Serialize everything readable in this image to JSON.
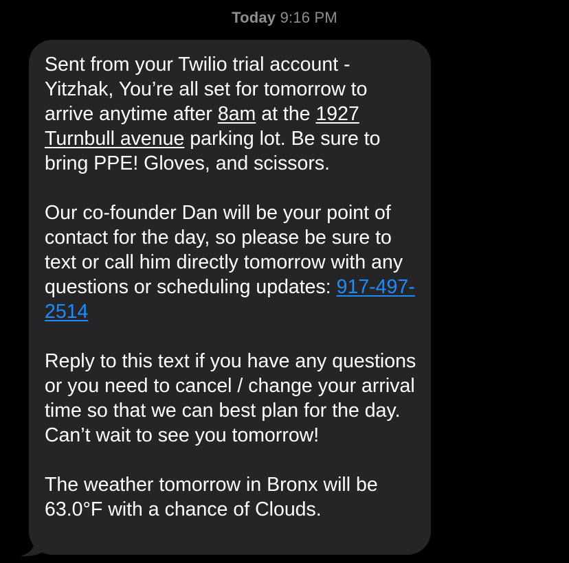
{
  "header": {
    "timestamp_day": "Today",
    "timestamp_time": "9:16 PM"
  },
  "message": {
    "p1_text_a": "Sent from your Twilio trial account - Yitzhak, You’re all set for tomorrow to arrive anytime after ",
    "p1_link_time": "8am",
    "p1_text_b": " at the ",
    "p1_link_address": "1927 Turnbull avenue",
    "p1_text_c": " parking lot.  Be sure to bring PPE! Gloves, and scissors.",
    "p2_text_a": "Our co-founder Dan will be your point of contact for the day, so please be sure to text or call him directly tomorrow with any questions or scheduling updates: ",
    "p2_link_phone": "917-497-2514",
    "p3_text": "Reply to this text if you have any questions or you need to cancel / change your arrival time so that we can best plan for the day. Can’t wait to see you tomorrow!",
    "p4_text": "The weather tomorrow in Bronx will be 63.0°F with a chance of Clouds."
  },
  "colors": {
    "background": "#000000",
    "bubble": "#252528",
    "timestamp": "#8e8e93",
    "link": "#1f8bff",
    "text": "#ffffff"
  }
}
